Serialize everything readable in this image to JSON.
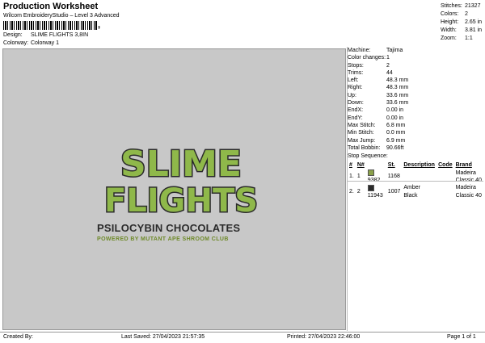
{
  "header": {
    "title": "Production Worksheet",
    "subtitle": "Wilcom EmbroideryStudio – Level 3 Advanced",
    "barcode_suffix": ",",
    "design_label": "Design:",
    "design_value": "SLIME FLIGHTS 3,8IN",
    "colorway_label": "Colorway:",
    "colorway_value": "Colorway 1"
  },
  "stats": [
    {
      "label": "Stitches:",
      "value": "21327"
    },
    {
      "label": "Colors:",
      "value": "2"
    },
    {
      "label": "Height:",
      "value": "2.65 in"
    },
    {
      "label": "Width:",
      "value": "3.81 in"
    },
    {
      "label": "Zoom:",
      "value": "1:1"
    }
  ],
  "artwork": {
    "line1": "SLIME",
    "line2": "FLIGHTS",
    "subtitle": "PSILOCYBIN CHOCOLATES",
    "tagline": "POWERED BY MUTANT APE SHROOM CLUB"
  },
  "machine_info": [
    {
      "label": "Machine:",
      "value": "Tajima"
    },
    {
      "label": "Color changes:",
      "value": "1"
    },
    {
      "label": "Stops:",
      "value": "2"
    },
    {
      "label": "Trims:",
      "value": "44"
    },
    {
      "label": "Left:",
      "value": "48.3 mm"
    },
    {
      "label": "Right:",
      "value": "48.3 mm"
    },
    {
      "label": "Up:",
      "value": "33.6 mm"
    },
    {
      "label": "Down:",
      "value": "33.6 mm"
    },
    {
      "label": "EndX:",
      "value": "0.00 in"
    },
    {
      "label": "EndY:",
      "value": "0.00 in"
    },
    {
      "label": "Max Stitch:",
      "value": "6.8 mm"
    },
    {
      "label": "Min Stitch:",
      "value": "0.0 mm"
    },
    {
      "label": "Max Jump:",
      "value": "6.9 mm"
    },
    {
      "label": "Total Bobbin:",
      "value": "90.66ft"
    }
  ],
  "stop_sequence": {
    "title": "Stop Sequence:",
    "headers": [
      "#",
      "N#",
      "",
      "St.",
      "Description",
      "Code",
      "Brand"
    ],
    "rows": [
      {
        "num": "1.",
        "n": "1",
        "color": "#8aa04a",
        "code_no": "9382",
        "st": "1168",
        "brand": "Madeira Classic 40",
        "description": "",
        "code": ""
      },
      {
        "num": "2.",
        "n": "2",
        "color": "#2a2a2a",
        "code_no": "11943",
        "st": "1007",
        "brand": "Madeira Classic 40",
        "description": "Amber Black",
        "code": ""
      }
    ]
  },
  "footer": {
    "created_by": "Created By:",
    "last_saved": "Last Saved: 27/04/2023 21:57:35",
    "printed": "Printed: 27/04/2023 22:46:00",
    "page": "Page 1 of 1"
  },
  "colors": {
    "slime_green": "#8fb84a",
    "slime_outline": "#2b2b2b",
    "tagline_green": "#6f8a2a",
    "canvas_gray": "#c8c8c8"
  }
}
